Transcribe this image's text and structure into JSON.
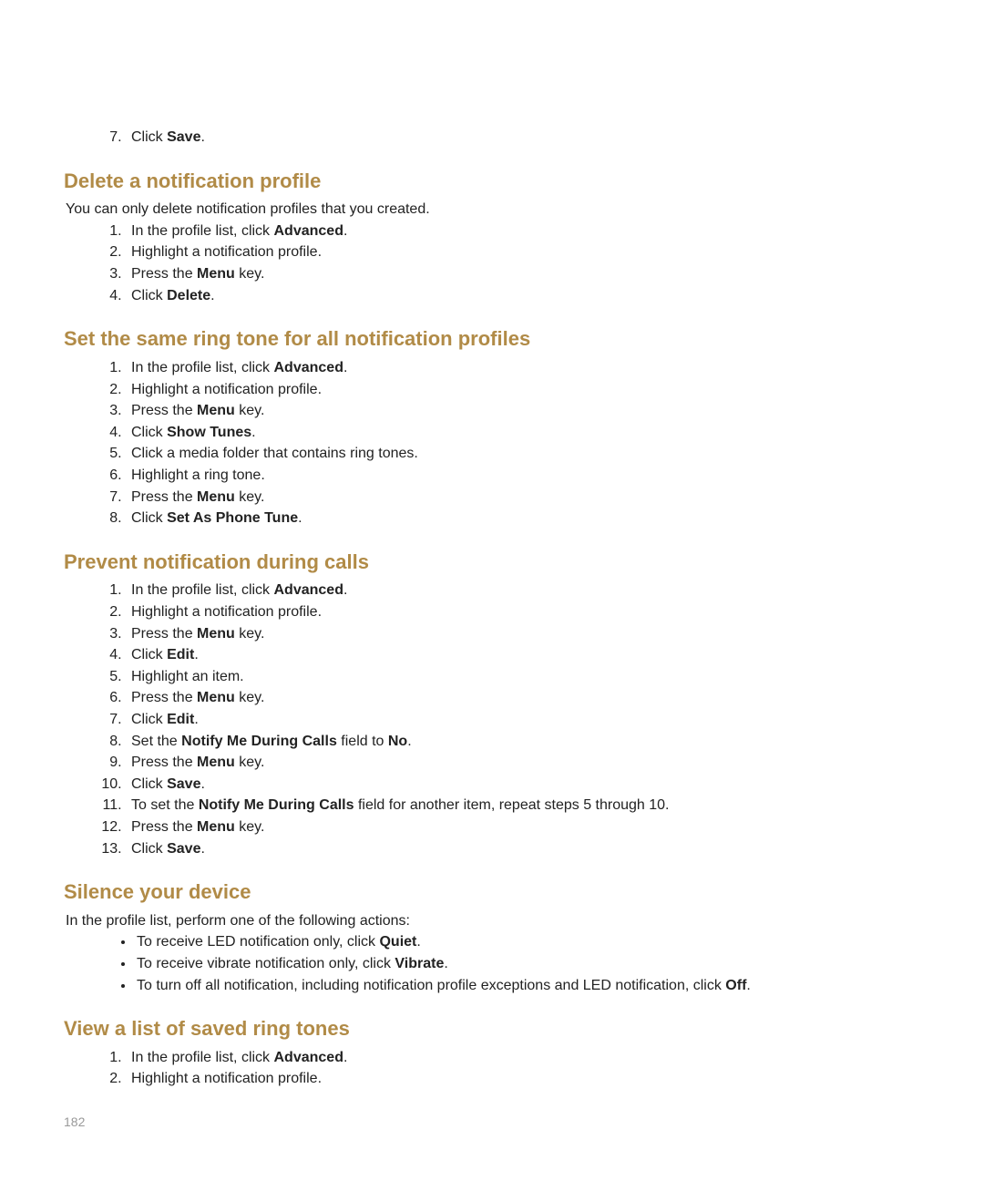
{
  "topList": {
    "items": [
      {
        "pre": "Click ",
        "bold": "Save",
        "post": "."
      }
    ]
  },
  "section1": {
    "heading": "Delete a notification profile",
    "intro": "You can only delete notification profiles that you created.",
    "items": [
      {
        "pre": "In the profile list, click ",
        "bold": "Advanced",
        "post": "."
      },
      {
        "pre": "Highlight a notification profile.",
        "bold": "",
        "post": ""
      },
      {
        "pre": "Press the ",
        "bold": "Menu",
        "post": " key."
      },
      {
        "pre": "Click ",
        "bold": "Delete",
        "post": "."
      }
    ]
  },
  "section2": {
    "heading": "Set the same ring tone for all notification profiles",
    "items": [
      {
        "pre": "In the profile list, click ",
        "bold": "Advanced",
        "post": "."
      },
      {
        "pre": "Highlight a notification profile.",
        "bold": "",
        "post": ""
      },
      {
        "pre": "Press the ",
        "bold": "Menu",
        "post": " key."
      },
      {
        "pre": "Click ",
        "bold": "Show Tunes",
        "post": "."
      },
      {
        "pre": "Click a media folder that contains ring tones.",
        "bold": "",
        "post": ""
      },
      {
        "pre": "Highlight a ring tone.",
        "bold": "",
        "post": ""
      },
      {
        "pre": "Press the ",
        "bold": "Menu",
        "post": " key."
      },
      {
        "pre": "Click ",
        "bold": "Set As Phone Tune",
        "post": "."
      }
    ]
  },
  "section3": {
    "heading": "Prevent notification during calls",
    "items": [
      {
        "pre": "In the profile list, click ",
        "bold": "Advanced",
        "post": "."
      },
      {
        "pre": "Highlight a notification profile.",
        "bold": "",
        "post": ""
      },
      {
        "pre": "Press the ",
        "bold": "Menu",
        "post": " key."
      },
      {
        "pre": "Click ",
        "bold": "Edit",
        "post": "."
      },
      {
        "pre": "Highlight an item.",
        "bold": "",
        "post": ""
      },
      {
        "pre": "Press the ",
        "bold": "Menu",
        "post": " key."
      },
      {
        "pre": "Click ",
        "bold": "Edit",
        "post": "."
      },
      {
        "pre": "Set the ",
        "bold": "Notify Me During Calls",
        "post": " field to ",
        "bold2": "No",
        "post2": "."
      },
      {
        "pre": "Press the ",
        "bold": "Menu",
        "post": " key."
      },
      {
        "pre": "Click ",
        "bold": "Save",
        "post": "."
      },
      {
        "pre": "To set the ",
        "bold": "Notify Me During Calls",
        "post": " field for another item, repeat steps 5 through 10."
      },
      {
        "pre": "Press the ",
        "bold": "Menu",
        "post": " key."
      },
      {
        "pre": "Click ",
        "bold": "Save",
        "post": "."
      }
    ]
  },
  "section4": {
    "heading": "Silence your device",
    "intro": "In the profile list, perform one of the following actions:",
    "items": [
      {
        "pre": "To receive LED notification only, click ",
        "bold": "Quiet",
        "post": "."
      },
      {
        "pre": "To receive vibrate notification only, click ",
        "bold": "Vibrate",
        "post": "."
      },
      {
        "pre": "To turn off all notification, including notification profile exceptions and LED notification, click ",
        "bold": "Off",
        "post": "."
      }
    ]
  },
  "section5": {
    "heading": "View a list of saved ring tones",
    "items": [
      {
        "pre": "In the profile list, click ",
        "bold": "Advanced",
        "post": "."
      },
      {
        "pre": "Highlight a notification profile.",
        "bold": "",
        "post": ""
      }
    ]
  },
  "pageNumber": "182"
}
